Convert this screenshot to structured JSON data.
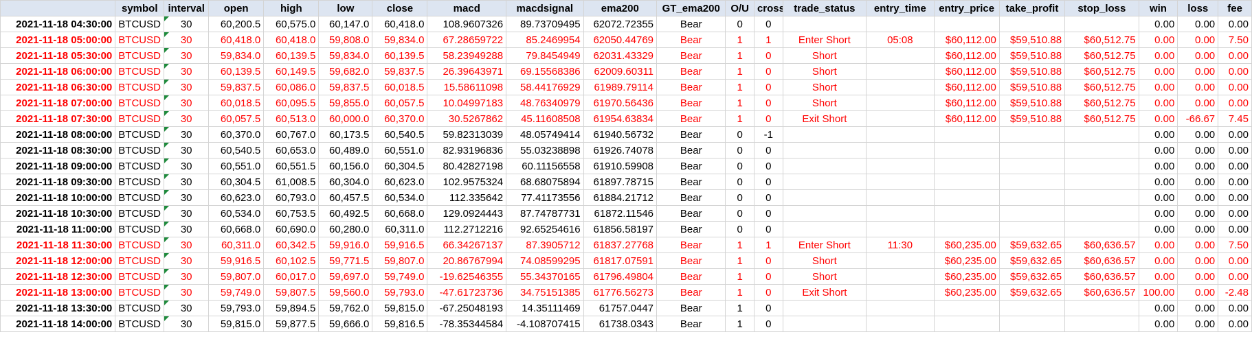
{
  "columns": [
    "",
    "symbol",
    "interval",
    "open",
    "high",
    "low",
    "close",
    "macd",
    "macdsignal",
    "ema200",
    "GT_ema200",
    "O/U",
    "cross",
    "trade_status",
    "entry_time",
    "entry_price",
    "take_profit",
    "stop_loss",
    "win",
    "loss",
    "fee"
  ],
  "colors": {
    "highlight": "#ff0000",
    "header_bg": "#dde5f1",
    "error_flag": "#1e8a3c"
  },
  "rows": [
    {
      "ts": "2021-11-18 04:30:00",
      "symbol": "BTCUSD",
      "interval": "30",
      "open": "60,200.5",
      "high": "60,575.0",
      "low": "60,147.0",
      "close": "60,418.0",
      "macd": "108.9607326",
      "macdsignal": "89.73709495",
      "ema200": "62072.72355",
      "gt": "Bear",
      "ou": "0",
      "cross": "0",
      "status": "",
      "entry_time": "",
      "entry_price": "",
      "take_profit": "",
      "stop_loss": "",
      "win": "0.00",
      "loss": "0.00",
      "fee": "0.00",
      "red": false
    },
    {
      "ts": "2021-11-18 05:00:00",
      "symbol": "BTCUSD",
      "interval": "30",
      "open": "60,418.0",
      "high": "60,418.0",
      "low": "59,808.0",
      "close": "59,834.0",
      "macd": "67.28659722",
      "macdsignal": "85.2469954",
      "ema200": "62050.44769",
      "gt": "Bear",
      "ou": "1",
      "cross": "1",
      "status": "Enter Short",
      "entry_time": "05:08",
      "entry_price": "$60,112.00",
      "take_profit": "$59,510.88",
      "stop_loss": "$60,512.75",
      "win": "0.00",
      "loss": "0.00",
      "fee": "7.50",
      "red": true
    },
    {
      "ts": "2021-11-18 05:30:00",
      "symbol": "BTCUSD",
      "interval": "30",
      "open": "59,834.0",
      "high": "60,139.5",
      "low": "59,834.0",
      "close": "60,139.5",
      "macd": "58.23949288",
      "macdsignal": "79.8454949",
      "ema200": "62031.43329",
      "gt": "Bear",
      "ou": "1",
      "cross": "0",
      "status": "Short",
      "entry_time": "",
      "entry_price": "$60,112.00",
      "take_profit": "$59,510.88",
      "stop_loss": "$60,512.75",
      "win": "0.00",
      "loss": "0.00",
      "fee": "0.00",
      "red": true
    },
    {
      "ts": "2021-11-18 06:00:00",
      "symbol": "BTCUSD",
      "interval": "30",
      "open": "60,139.5",
      "high": "60,149.5",
      "low": "59,682.0",
      "close": "59,837.5",
      "macd": "26.39643971",
      "macdsignal": "69.15568386",
      "ema200": "62009.60311",
      "gt": "Bear",
      "ou": "1",
      "cross": "0",
      "status": "Short",
      "entry_time": "",
      "entry_price": "$60,112.00",
      "take_profit": "$59,510.88",
      "stop_loss": "$60,512.75",
      "win": "0.00",
      "loss": "0.00",
      "fee": "0.00",
      "red": true
    },
    {
      "ts": "2021-11-18 06:30:00",
      "symbol": "BTCUSD",
      "interval": "30",
      "open": "59,837.5",
      "high": "60,086.0",
      "low": "59,837.5",
      "close": "60,018.5",
      "macd": "15.58611098",
      "macdsignal": "58.44176929",
      "ema200": "61989.79114",
      "gt": "Bear",
      "ou": "1",
      "cross": "0",
      "status": "Short",
      "entry_time": "",
      "entry_price": "$60,112.00",
      "take_profit": "$59,510.88",
      "stop_loss": "$60,512.75",
      "win": "0.00",
      "loss": "0.00",
      "fee": "0.00",
      "red": true
    },
    {
      "ts": "2021-11-18 07:00:00",
      "symbol": "BTCUSD",
      "interval": "30",
      "open": "60,018.5",
      "high": "60,095.5",
      "low": "59,855.0",
      "close": "60,057.5",
      "macd": "10.04997183",
      "macdsignal": "48.76340979",
      "ema200": "61970.56436",
      "gt": "Bear",
      "ou": "1",
      "cross": "0",
      "status": "Short",
      "entry_time": "",
      "entry_price": "$60,112.00",
      "take_profit": "$59,510.88",
      "stop_loss": "$60,512.75",
      "win": "0.00",
      "loss": "0.00",
      "fee": "0.00",
      "red": true
    },
    {
      "ts": "2021-11-18 07:30:00",
      "symbol": "BTCUSD",
      "interval": "30",
      "open": "60,057.5",
      "high": "60,513.0",
      "low": "60,000.0",
      "close": "60,370.0",
      "macd": "30.5267862",
      "macdsignal": "45.11608508",
      "ema200": "61954.63834",
      "gt": "Bear",
      "ou": "1",
      "cross": "0",
      "status": "Exit Short",
      "entry_time": "",
      "entry_price": "$60,112.00",
      "take_profit": "$59,510.88",
      "stop_loss": "$60,512.75",
      "win": "0.00",
      "loss": "-66.67",
      "fee": "7.45",
      "red": true
    },
    {
      "ts": "2021-11-18 08:00:00",
      "symbol": "BTCUSD",
      "interval": "30",
      "open": "60,370.0",
      "high": "60,767.0",
      "low": "60,173.5",
      "close": "60,540.5",
      "macd": "59.82313039",
      "macdsignal": "48.05749414",
      "ema200": "61940.56732",
      "gt": "Bear",
      "ou": "0",
      "cross": "-1",
      "status": "",
      "entry_time": "",
      "entry_price": "",
      "take_profit": "",
      "stop_loss": "",
      "win": "0.00",
      "loss": "0.00",
      "fee": "0.00",
      "red": false
    },
    {
      "ts": "2021-11-18 08:30:00",
      "symbol": "BTCUSD",
      "interval": "30",
      "open": "60,540.5",
      "high": "60,653.0",
      "low": "60,489.0",
      "close": "60,551.0",
      "macd": "82.93196836",
      "macdsignal": "55.03238898",
      "ema200": "61926.74078",
      "gt": "Bear",
      "ou": "0",
      "cross": "0",
      "status": "",
      "entry_time": "",
      "entry_price": "",
      "take_profit": "",
      "stop_loss": "",
      "win": "0.00",
      "loss": "0.00",
      "fee": "0.00",
      "red": false
    },
    {
      "ts": "2021-11-18 09:00:00",
      "symbol": "BTCUSD",
      "interval": "30",
      "open": "60,551.0",
      "high": "60,551.5",
      "low": "60,156.0",
      "close": "60,304.5",
      "macd": "80.42827198",
      "macdsignal": "60.11156558",
      "ema200": "61910.59908",
      "gt": "Bear",
      "ou": "0",
      "cross": "0",
      "status": "",
      "entry_time": "",
      "entry_price": "",
      "take_profit": "",
      "stop_loss": "",
      "win": "0.00",
      "loss": "0.00",
      "fee": "0.00",
      "red": false
    },
    {
      "ts": "2021-11-18 09:30:00",
      "symbol": "BTCUSD",
      "interval": "30",
      "open": "60,304.5",
      "high": "61,008.5",
      "low": "60,304.0",
      "close": "60,623.0",
      "macd": "102.9575324",
      "macdsignal": "68.68075894",
      "ema200": "61897.78715",
      "gt": "Bear",
      "ou": "0",
      "cross": "0",
      "status": "",
      "entry_time": "",
      "entry_price": "",
      "take_profit": "",
      "stop_loss": "",
      "win": "0.00",
      "loss": "0.00",
      "fee": "0.00",
      "red": false
    },
    {
      "ts": "2021-11-18 10:00:00",
      "symbol": "BTCUSD",
      "interval": "30",
      "open": "60,623.0",
      "high": "60,793.0",
      "low": "60,457.5",
      "close": "60,534.0",
      "macd": "112.335642",
      "macdsignal": "77.41173556",
      "ema200": "61884.21712",
      "gt": "Bear",
      "ou": "0",
      "cross": "0",
      "status": "",
      "entry_time": "",
      "entry_price": "",
      "take_profit": "",
      "stop_loss": "",
      "win": "0.00",
      "loss": "0.00",
      "fee": "0.00",
      "red": false
    },
    {
      "ts": "2021-11-18 10:30:00",
      "symbol": "BTCUSD",
      "interval": "30",
      "open": "60,534.0",
      "high": "60,753.5",
      "low": "60,492.5",
      "close": "60,668.0",
      "macd": "129.0924443",
      "macdsignal": "87.74787731",
      "ema200": "61872.11546",
      "gt": "Bear",
      "ou": "0",
      "cross": "0",
      "status": "",
      "entry_time": "",
      "entry_price": "",
      "take_profit": "",
      "stop_loss": "",
      "win": "0.00",
      "loss": "0.00",
      "fee": "0.00",
      "red": false
    },
    {
      "ts": "2021-11-18 11:00:00",
      "symbol": "BTCUSD",
      "interval": "30",
      "open": "60,668.0",
      "high": "60,690.0",
      "low": "60,280.0",
      "close": "60,311.0",
      "macd": "112.2712216",
      "macdsignal": "92.65254616",
      "ema200": "61856.58197",
      "gt": "Bear",
      "ou": "0",
      "cross": "0",
      "status": "",
      "entry_time": "",
      "entry_price": "",
      "take_profit": "",
      "stop_loss": "",
      "win": "0.00",
      "loss": "0.00",
      "fee": "0.00",
      "red": false
    },
    {
      "ts": "2021-11-18 11:30:00",
      "symbol": "BTCUSD",
      "interval": "30",
      "open": "60,311.0",
      "high": "60,342.5",
      "low": "59,916.0",
      "close": "59,916.5",
      "macd": "66.34267137",
      "macdsignal": "87.3905712",
      "ema200": "61837.27768",
      "gt": "Bear",
      "ou": "1",
      "cross": "1",
      "status": "Enter Short",
      "entry_time": "11:30",
      "entry_price": "$60,235.00",
      "take_profit": "$59,632.65",
      "stop_loss": "$60,636.57",
      "win": "0.00",
      "loss": "0.00",
      "fee": "7.50",
      "red": true
    },
    {
      "ts": "2021-11-18 12:00:00",
      "symbol": "BTCUSD",
      "interval": "30",
      "open": "59,916.5",
      "high": "60,102.5",
      "low": "59,771.5",
      "close": "59,807.0",
      "macd": "20.86767994",
      "macdsignal": "74.08599295",
      "ema200": "61817.07591",
      "gt": "Bear",
      "ou": "1",
      "cross": "0",
      "status": "Short",
      "entry_time": "",
      "entry_price": "$60,235.00",
      "take_profit": "$59,632.65",
      "stop_loss": "$60,636.57",
      "win": "0.00",
      "loss": "0.00",
      "fee": "0.00",
      "red": true
    },
    {
      "ts": "2021-11-18 12:30:00",
      "symbol": "BTCUSD",
      "interval": "30",
      "open": "59,807.0",
      "high": "60,017.0",
      "low": "59,697.0",
      "close": "59,749.0",
      "macd": "-19.62546355",
      "macdsignal": "55.34370165",
      "ema200": "61796.49804",
      "gt": "Bear",
      "ou": "1",
      "cross": "0",
      "status": "Short",
      "entry_time": "",
      "entry_price": "$60,235.00",
      "take_profit": "$59,632.65",
      "stop_loss": "$60,636.57",
      "win": "0.00",
      "loss": "0.00",
      "fee": "0.00",
      "red": true
    },
    {
      "ts": "2021-11-18 13:00:00",
      "symbol": "BTCUSD",
      "interval": "30",
      "open": "59,749.0",
      "high": "59,807.5",
      "low": "59,560.0",
      "close": "59,793.0",
      "macd": "-47.61723736",
      "macdsignal": "34.75151385",
      "ema200": "61776.56273",
      "gt": "Bear",
      "ou": "1",
      "cross": "0",
      "status": "Exit Short",
      "entry_time": "",
      "entry_price": "$60,235.00",
      "take_profit": "$59,632.65",
      "stop_loss": "$60,636.57",
      "win": "100.00",
      "loss": "0.00",
      "fee": "-2.48",
      "red": true
    },
    {
      "ts": "2021-11-18 13:30:00",
      "symbol": "BTCUSD",
      "interval": "30",
      "open": "59,793.0",
      "high": "59,894.5",
      "low": "59,762.0",
      "close": "59,815.0",
      "macd": "-67.25048193",
      "macdsignal": "14.35111469",
      "ema200": "61757.0447",
      "gt": "Bear",
      "ou": "1",
      "cross": "0",
      "status": "",
      "entry_time": "",
      "entry_price": "",
      "take_profit": "",
      "stop_loss": "",
      "win": "0.00",
      "loss": "0.00",
      "fee": "0.00",
      "red": false
    },
    {
      "ts": "2021-11-18 14:00:00",
      "symbol": "BTCUSD",
      "interval": "30",
      "open": "59,815.0",
      "high": "59,877.5",
      "low": "59,666.0",
      "close": "59,816.5",
      "macd": "-78.35344584",
      "macdsignal": "-4.108707415",
      "ema200": "61738.0343",
      "gt": "Bear",
      "ou": "1",
      "cross": "0",
      "status": "",
      "entry_time": "",
      "entry_price": "",
      "take_profit": "",
      "stop_loss": "",
      "win": "0.00",
      "loss": "0.00",
      "fee": "0.00",
      "red": false
    }
  ]
}
